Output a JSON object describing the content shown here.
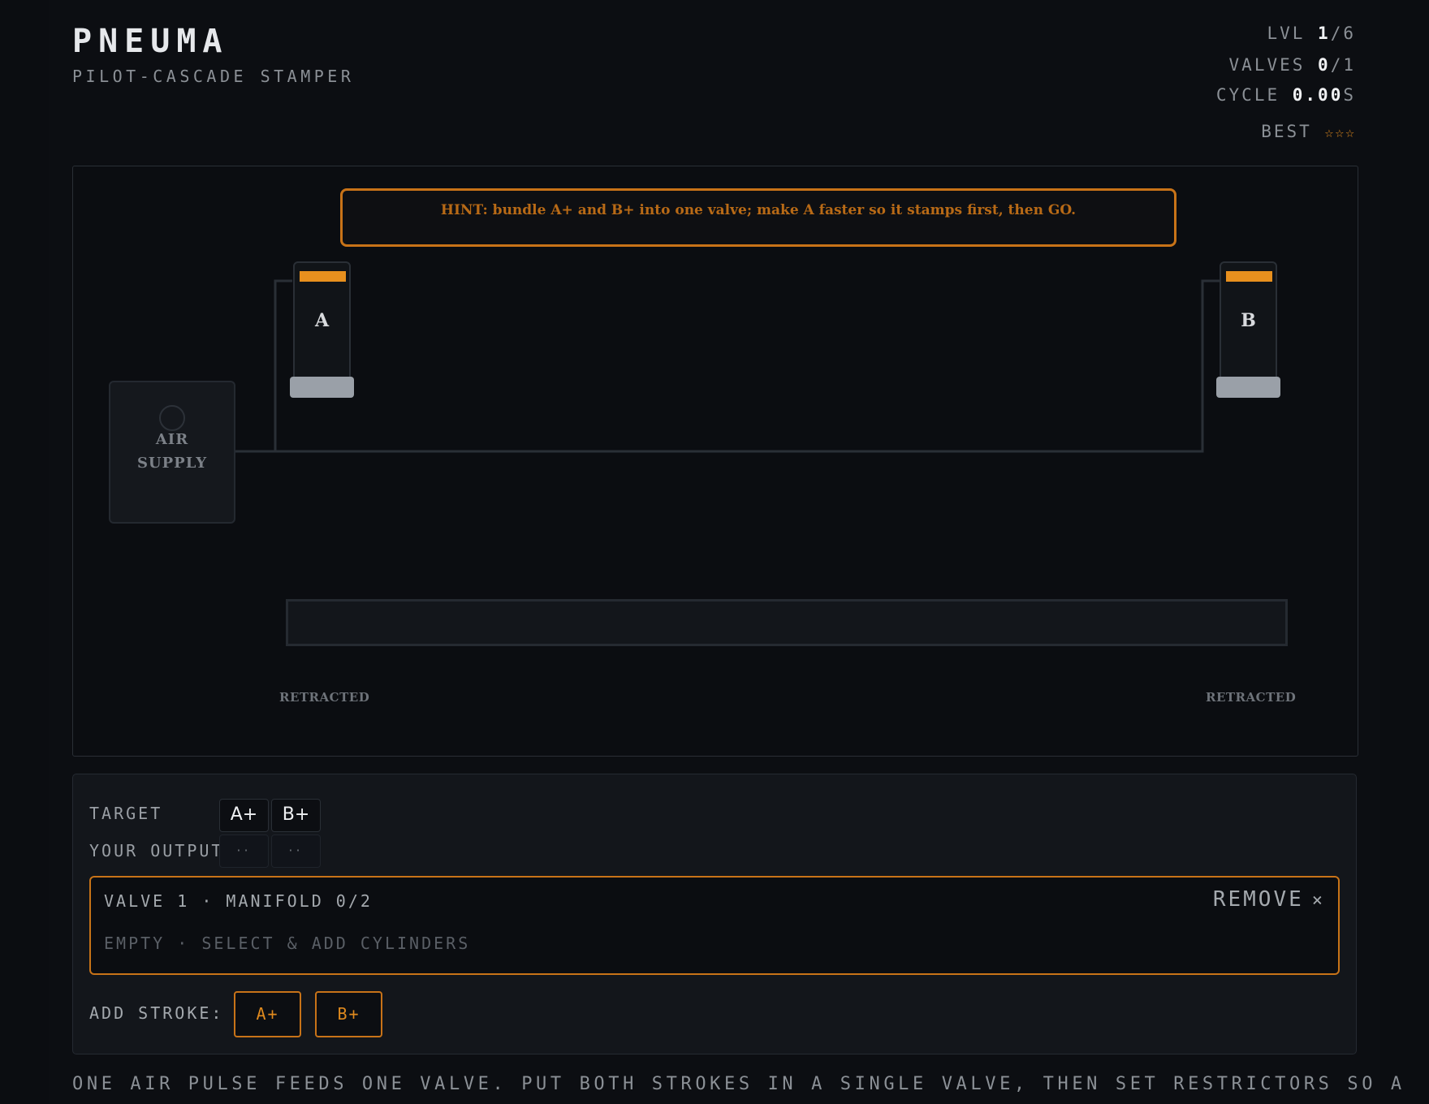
{
  "header": {
    "title": "PNEUMA",
    "subtitle": "PILOT-CASCADE STAMPER"
  },
  "stats": {
    "level_label": "LVL",
    "level_current": "1",
    "level_total": "/6",
    "valves_label": "VALVES",
    "valves_current": "0",
    "valves_total": "/1",
    "cycle_label": "CYCLE",
    "cycle_value": "0.00",
    "cycle_unit": "S",
    "best_label": "BEST",
    "best_stars": "☆☆☆",
    "best_stars_value": 0,
    "best_stars_max": 3
  },
  "board": {
    "hint": "HINT: bundle A+ and B+ into one valve; make A faster so it stamps first, then GO.",
    "cylinders": [
      {
        "label": "A",
        "state": "RETRACTED"
      },
      {
        "label": "B",
        "state": "RETRACTED"
      }
    ],
    "air_supply": {
      "line1": "AIR",
      "line2": "SUPPLY"
    }
  },
  "panel": {
    "target_label": "TARGET",
    "target_sequence": [
      "A+",
      "B+"
    ],
    "output_label": "YOUR OUTPUT",
    "output_sequence": [
      "··",
      "··"
    ],
    "valve": {
      "title": "VALVE 1 · MANIFOLD 0/2",
      "empty_text": "EMPTY · SELECT & ADD CYLINDERS",
      "remove_label": "REMOVE",
      "remove_icon": "×"
    },
    "add_stroke_label": "ADD STROKE:",
    "add_stroke_buttons": [
      "A+",
      "B+"
    ]
  },
  "footer": {
    "note": "ONE AIR PULSE FEEDS ONE VALVE. PUT BOTH STROKES IN A SINGLE VALVE, THEN SET RESTRICTORS SO A"
  },
  "colors": {
    "accent": "#e08a1e",
    "accent_border": "#c87318",
    "background": "#0b0d11",
    "panel": "#13161b",
    "piston": "#9aa0a8"
  }
}
